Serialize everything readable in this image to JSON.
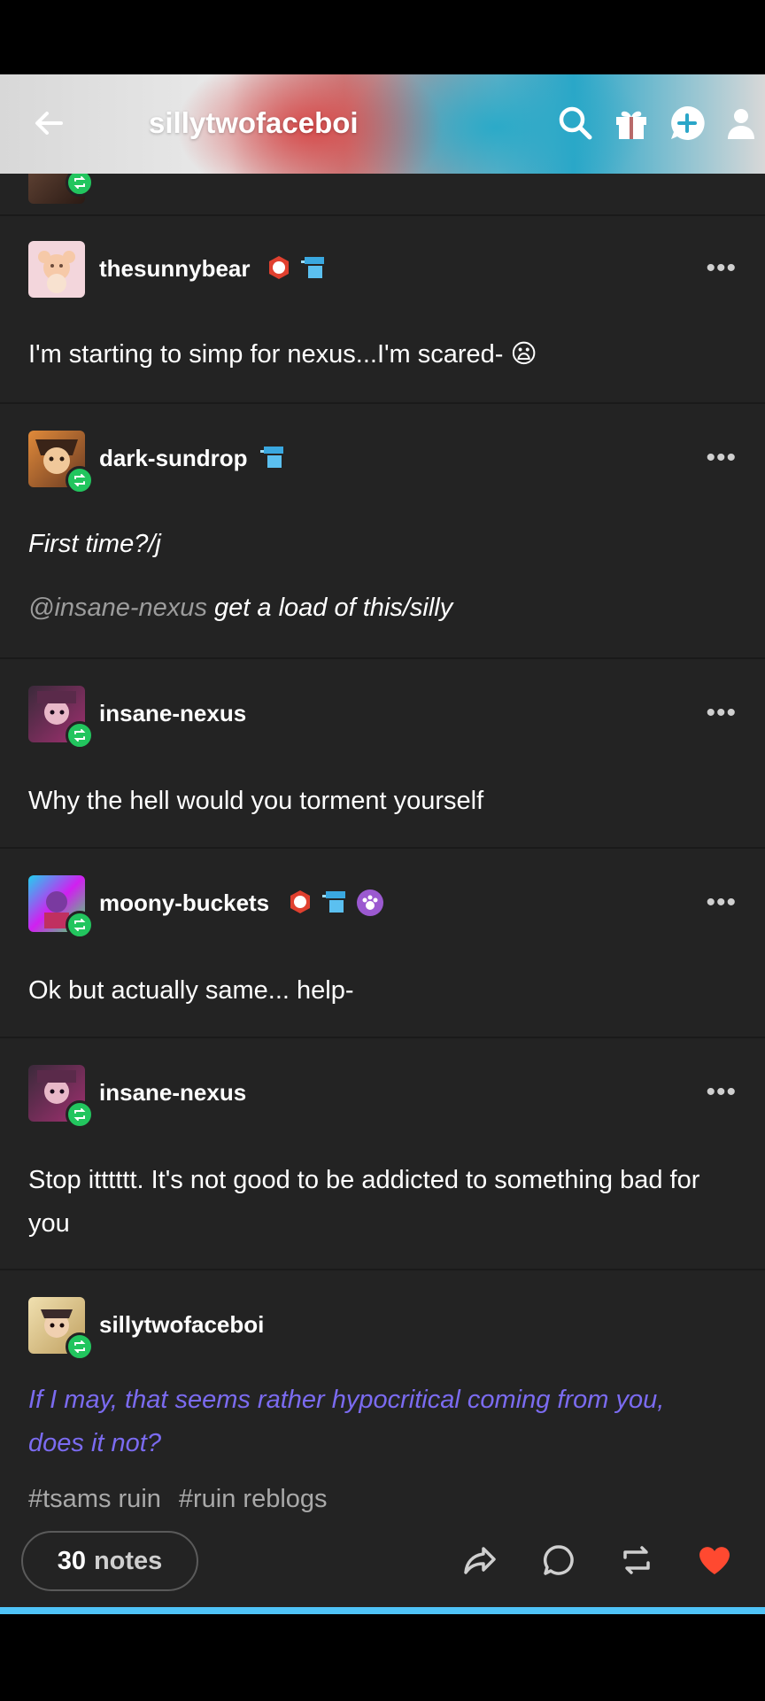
{
  "header": {
    "title": "sillytwofaceboi",
    "icons": [
      "back-arrow-icon",
      "search-icon",
      "gift-icon",
      "new-message-icon",
      "account-icon"
    ]
  },
  "posts": [
    {
      "username": "thesunnybear",
      "text": "I'm starting to simp for nexus...I'm scared- 😦",
      "more": "•••"
    },
    {
      "username": "dark-sundrop",
      "line1": "First time?/j",
      "mention": "@insane-nexus",
      "line2_rest": " get a load of this/silly",
      "more": "•••"
    },
    {
      "username": "insane-nexus",
      "text": "Why the hell would you torment yourself",
      "more": "•••"
    },
    {
      "username": "moony-buckets",
      "text": "Ok but actually same... help-",
      "more": "•••"
    },
    {
      "username": "insane-nexus",
      "text": "Stop itttttt. It's not good to be addicted to something bad for you",
      "more": "•••"
    },
    {
      "username": "sillytwofaceboi",
      "text": "If I may, that seems rather hypocritical coming from you, does it not?"
    }
  ],
  "tags": [
    "#tsams ruin",
    "#ruin reblogs"
  ],
  "footer": {
    "notes_count": "30",
    "notes_label": "notes"
  },
  "colors": {
    "accent_blue": "#4fc3f7",
    "reblog_green": "#22c55e",
    "like_red": "#ff4930",
    "purple_text": "#7b6bf0"
  }
}
